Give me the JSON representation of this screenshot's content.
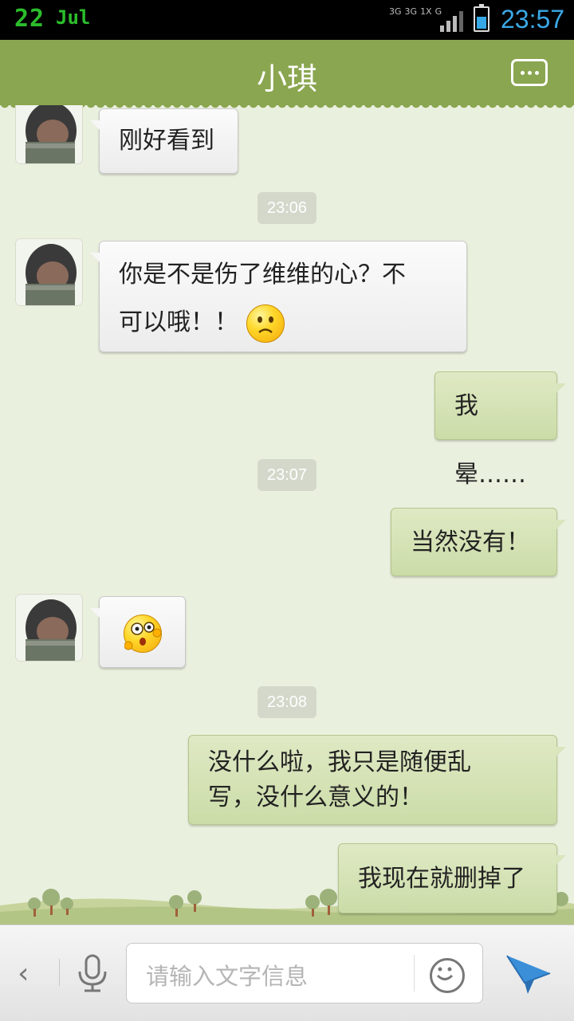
{
  "status_bar": {
    "date_day": "22",
    "date_month": "Jul",
    "network_labels": [
      "3G",
      "3G",
      "1X",
      "G"
    ],
    "time": "23:57"
  },
  "header": {
    "title": "小琪"
  },
  "messages": [
    {
      "side": "in",
      "text": "刚好看到"
    },
    {
      "timestamp": "23:06"
    },
    {
      "side": "in",
      "text_line1": "你是不是伤了维维的心？不",
      "text_line2": "可以哦！！",
      "emoji": "sad-face-emoji"
    },
    {
      "side": "out",
      "text": "我晕……"
    },
    {
      "timestamp": "23:07"
    },
    {
      "side": "out",
      "text": "当然没有！"
    },
    {
      "side": "in",
      "emoji": "surprised-face-emoji"
    },
    {
      "timestamp": "23:08"
    },
    {
      "side": "out",
      "text_line1": "没什么啦，我只是随便乱",
      "text_line2": "写，没什么意义的！"
    },
    {
      "side": "out",
      "text": "我现在就删掉了"
    }
  ],
  "input_bar": {
    "back_label": "‹",
    "placeholder": "请输入文字信息"
  },
  "colors": {
    "header": "#8aa650",
    "background": "#eaf0de",
    "outgoing_bubble": "#d4e2b5",
    "incoming_bubble": "#f4f4f4",
    "time_accent": "#3aa9e6"
  }
}
